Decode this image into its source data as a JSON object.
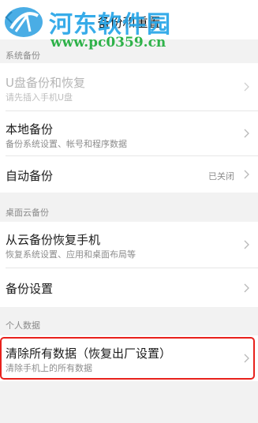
{
  "header": {
    "title": "备份和重置",
    "back_icon": "chevron-left-icon"
  },
  "watermark": {
    "site_name": "河东软件园",
    "url": "www.pc0359.cn"
  },
  "sections": {
    "system": {
      "label": "系统备份",
      "usb_backup": {
        "title": "U盘备份和恢复",
        "subtitle": "请先插入手机U盘"
      },
      "local_backup": {
        "title": "本地备份",
        "subtitle": "备份系统设置、帐号和程序数据"
      },
      "auto_backup": {
        "title": "自动备份",
        "value": "已关闭"
      }
    },
    "cloud": {
      "label": "桌面云备份",
      "restore": {
        "title": "从云备份恢复手机",
        "subtitle": "恢复系统设置、应用和桌面布局等"
      },
      "settings": {
        "title": "备份设置"
      }
    },
    "personal": {
      "label": "个人数据",
      "factory_reset": {
        "title": "清除所有数据（恢复出厂设置）",
        "subtitle": "清除手机上的所有数据"
      }
    }
  },
  "colors": {
    "highlight": "#e8211c",
    "watermark_blue": "#27a6e8",
    "watermark_green": "#2fb24a"
  }
}
